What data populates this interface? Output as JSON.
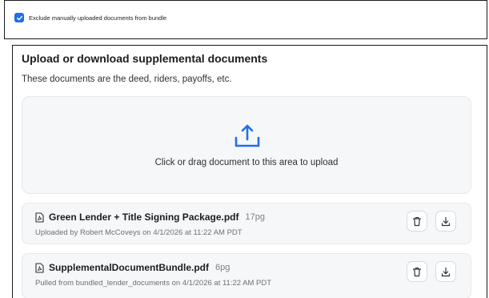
{
  "settings": {
    "exclude_checkbox": {
      "label": "Exclude manually uploaded documents from bundle",
      "checked": true
    }
  },
  "supplemental": {
    "title": "Upload or download supplemental documents",
    "subtitle": "These documents are the deed, riders, payoffs, etc.",
    "dropzone_text": "Click or drag document to this area to upload",
    "files": [
      {
        "name": "Green Lender + Title Signing Package.pdf",
        "pages": "17pg",
        "meta": "Uploaded by Robert McCoveys on 4/1/2026 at 11:22 AM PDT"
      },
      {
        "name": "SupplementalDocumentBundle.pdf",
        "pages": "6pg",
        "meta": "Pulled from bundled_lender_documents on 4/1/2026 at 11:22 AM PDT"
      }
    ]
  },
  "colors": {
    "accent": "#1f6feb",
    "card_bg": "#f6f7f8",
    "border": "#e6e8eb"
  },
  "icons": [
    "check-icon",
    "upload-icon",
    "pdf-file-icon",
    "trash-icon",
    "download-icon"
  ]
}
